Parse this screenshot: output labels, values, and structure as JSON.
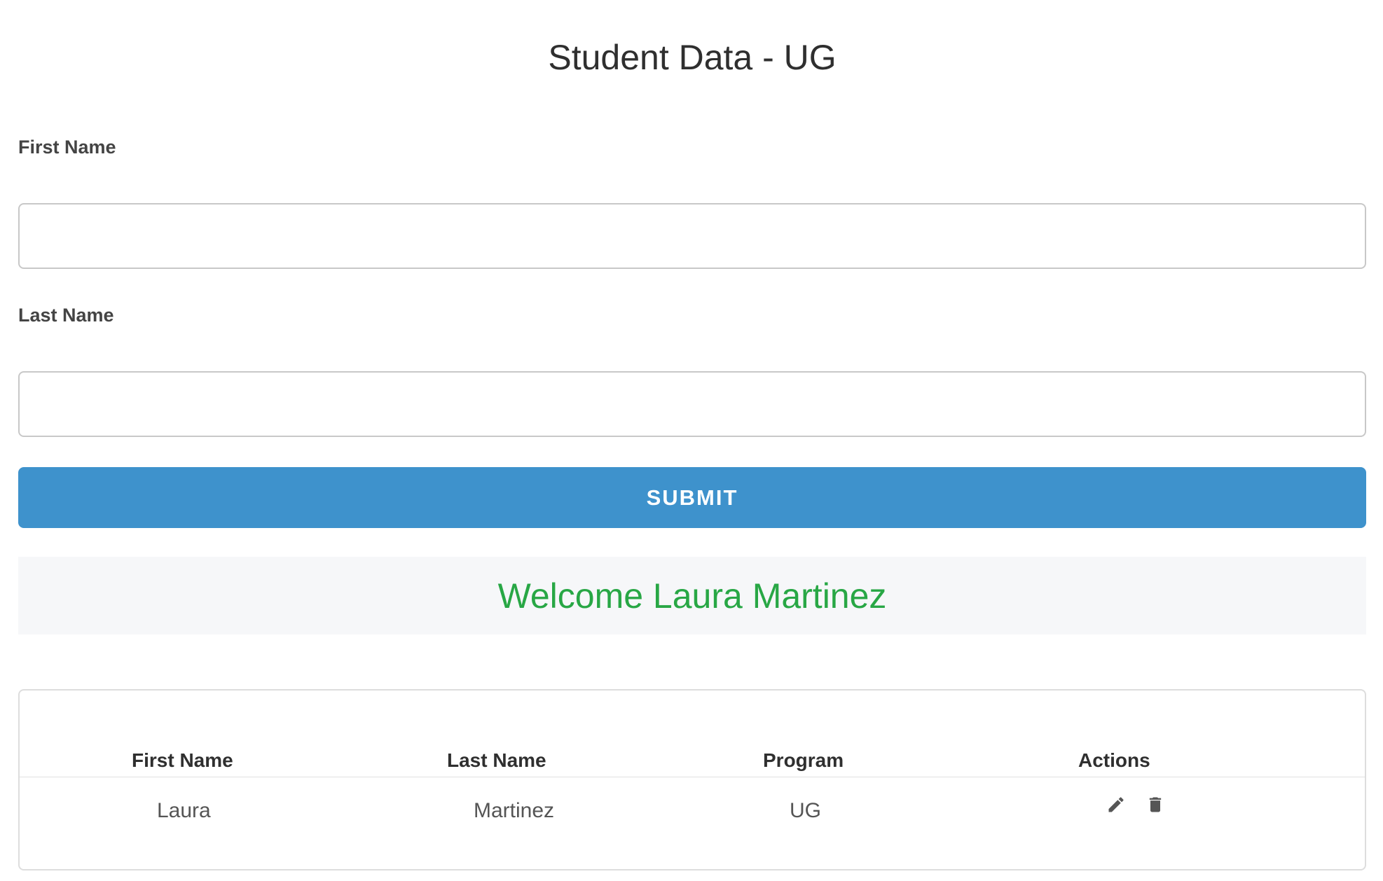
{
  "header": {
    "title": "Student Data - UG"
  },
  "form": {
    "first_name_label": "First Name",
    "first_name_value": "",
    "last_name_label": "Last Name",
    "last_name_value": "",
    "submit_label": "SUBMIT"
  },
  "welcome": {
    "message": "Welcome Laura Martinez",
    "color": "#28a745"
  },
  "table": {
    "columns": [
      "First Name",
      "Last Name",
      "Program",
      "Actions"
    ],
    "rows": [
      {
        "first_name": "Laura",
        "last_name": "Martinez",
        "program": "UG",
        "actions": [
          "edit-icon",
          "delete-icon"
        ]
      }
    ]
  },
  "colors": {
    "submit_button": "#3e92cc",
    "welcome_background": "#f6f7f9",
    "icon": "#555555"
  }
}
